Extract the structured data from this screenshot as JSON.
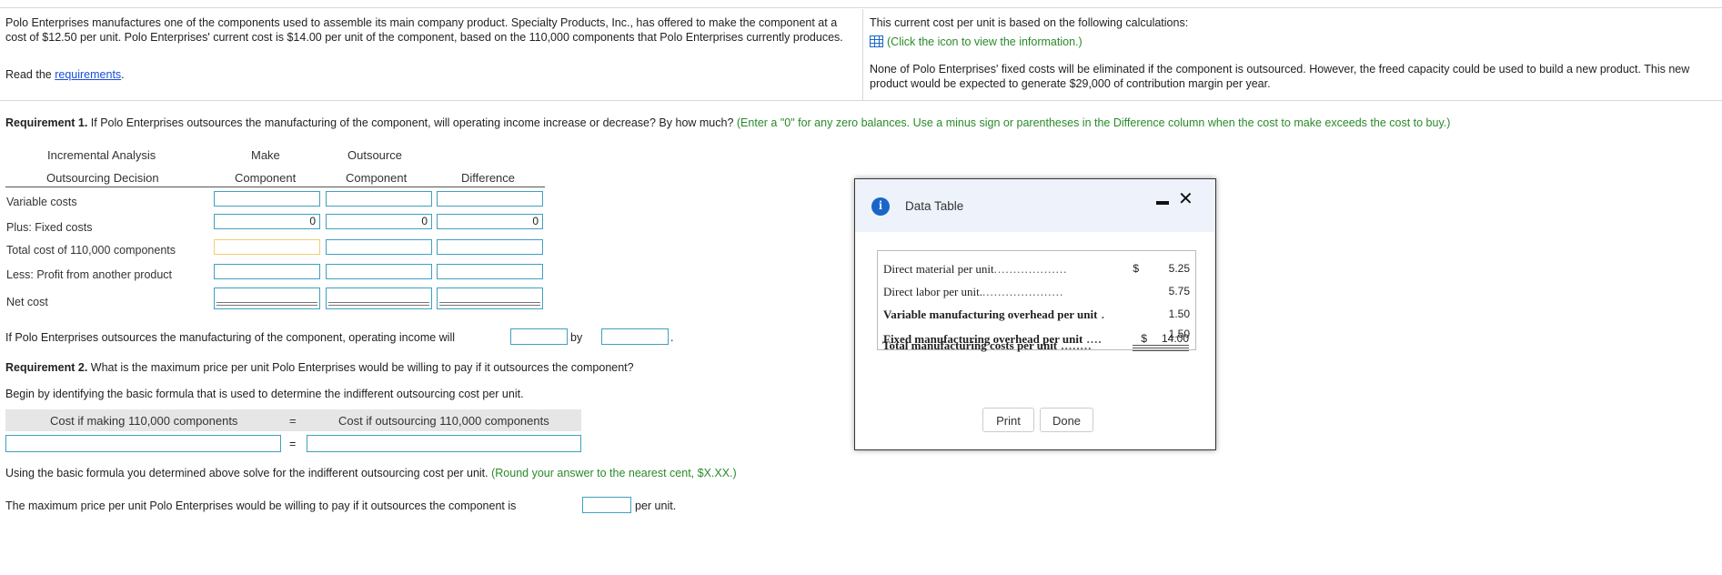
{
  "intro": {
    "para1": "Polo Enterprises manufactures one of the components used to assemble its main company product. Specialty Products, Inc., has offered to make the component at a cost of $12.50 per unit. Polo Enterprises' current cost is $14.00 per unit of the component, based on the 110,000 components that Polo Enterprises currently produces.",
    "read_prefix": "Read the ",
    "read_link": "requirements",
    "read_suffix": ".",
    "calc_text": "This current cost per unit is based on the following calculations:",
    "calc_link": "(Click the icon to view the information.)",
    "para2": "None of Polo Enterprises' fixed costs will be eliminated if the component is outsourced. However, the freed capacity could be used to build a new product. This new product would be expected to generate $29,000 of contribution margin per year."
  },
  "req1": {
    "label": "Requirement 1.",
    "text": " If Polo Enterprises outsources the manufacturing of the component, will operating income increase or decrease? By how much? ",
    "hint": "(Enter a \"0\" for any zero balances. Use a minus sign or parentheses in the Difference column when the cost to make exceeds the cost to buy.)"
  },
  "table": {
    "title1": "Incremental Analysis",
    "title2": "Outsourcing Decision",
    "col_make1": "Make",
    "col_make2": "Component",
    "col_out1": "Outsource",
    "col_out2": "Component",
    "col_diff": "Difference",
    "rows": [
      {
        "label": "Variable costs"
      },
      {
        "label": "Plus: Fixed costs",
        "make": "0",
        "out": "0",
        "diff": "0"
      },
      {
        "label": "Total cost of 110,000 components"
      },
      {
        "label": "Less: Profit from another product"
      },
      {
        "label": "Net cost"
      }
    ]
  },
  "income": {
    "text": "If Polo Enterprises outsources the manufacturing of the component, operating income will",
    "by": "by",
    "period": "."
  },
  "req2": {
    "label": "Requirement 2.",
    "text": " What is the maximum price per unit Polo Enterprises would be willing to pay if it outsources the component?",
    "begin": "Begin by identifying the basic formula that is used to determine the indifferent outsourcing cost per unit.",
    "formula_left": "Cost if making 110,000 components",
    "formula_eq": "=",
    "formula_right": "Cost if outsourcing 110,000 components",
    "using": "Using the basic formula you determined above solve for the indifferent outsourcing cost per unit. ",
    "using_hint": "(Round your answer to the nearest  cent, $X.XX.)",
    "max_text": "The maximum price per unit Polo Enterprises would be willing to pay if it outsources the component is",
    "per_unit": "per unit."
  },
  "dialog": {
    "title": "Data Table",
    "info_icon": "i",
    "close_icon": "✕",
    "rows": [
      {
        "label": "Direct material per unit",
        "dollar": "$",
        "value": "5.25"
      },
      {
        "label": "Direct labor per unit.",
        "dollar": "",
        "value": "5.75"
      },
      {
        "label": "Variable manufacturing overhead per unit",
        "dollar": "",
        "value": "1.50"
      },
      {
        "label": "Fixed manufacturing overhead per unit",
        "dollar": "",
        "value": "1.50"
      },
      {
        "label": "Total manufacturing costs per unit",
        "dollar": "$",
        "value": "14.00"
      }
    ],
    "print_label": "Print",
    "done_label": "Done"
  },
  "colors": {
    "accent": "#1a66c8",
    "hint_green": "#2a8a2a",
    "input_border": "#3fa0c0"
  }
}
